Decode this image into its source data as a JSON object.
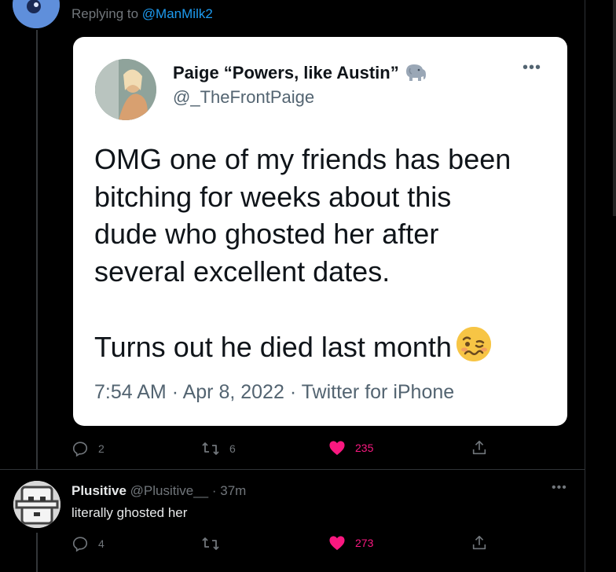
{
  "reply_context": {
    "prefix": "Replying to",
    "mention": "@ManMilk2"
  },
  "quoted_tweet": {
    "name": "Paige “Powers, like Austin”",
    "name_emoji": "elephant-icon",
    "handle": "@_TheFrontPaige",
    "more_label": "•••",
    "body_line1": "OMG one of my friends has been",
    "body_line2": "bitching for weeks about this",
    "body_line3": "dude who ghosted her after",
    "body_line4": "several excellent dates.",
    "body_line5": "Turns out he died last month",
    "body_emoji": "woozy-face-icon",
    "time": "7:54 AM",
    "date": "Apr 8, 2022",
    "client": "Twitter for iPhone",
    "sep": "·"
  },
  "tweet_actions": {
    "replies": "2",
    "retweets": "6",
    "likes": "235",
    "liked": true
  },
  "reply": {
    "name": "Plusitive",
    "handle": "@Plusitive__",
    "time": "· 37m",
    "text": "literally ghosted her",
    "more_label": "•••",
    "replies": "4",
    "retweets": "",
    "likes": "273",
    "liked": true
  },
  "colors": {
    "background": "#000000",
    "accent": "#1d9bf0",
    "like": "#f91880",
    "muted": "#71767b"
  }
}
